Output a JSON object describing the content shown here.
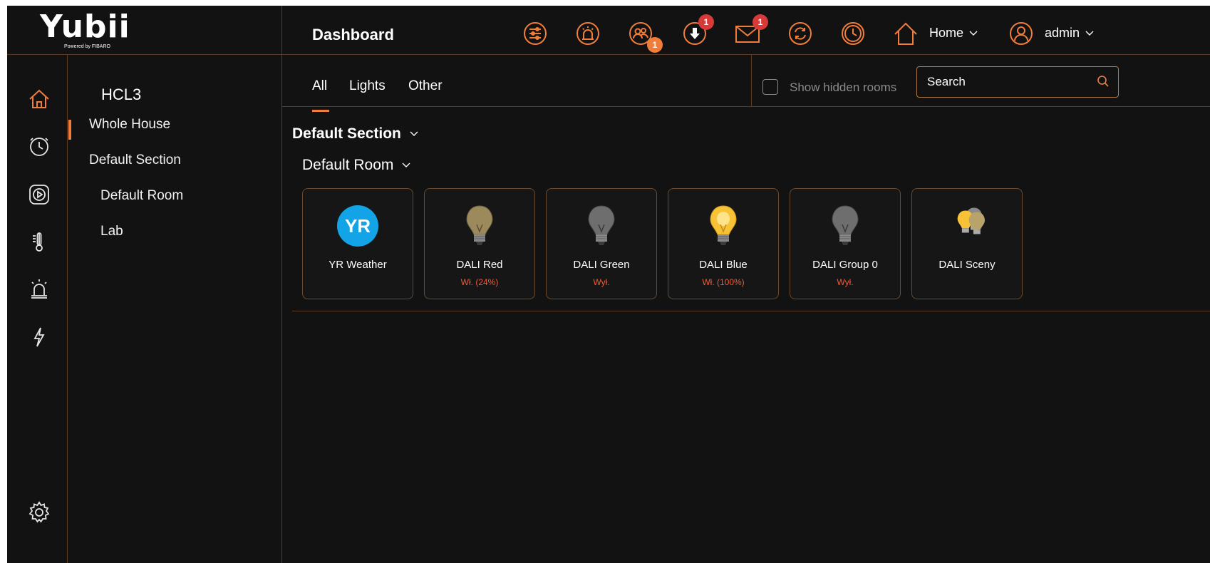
{
  "logo": {
    "word": "Yubii",
    "sub": "Powered by FIBARO"
  },
  "header": {
    "title": "Dashboard",
    "badges": {
      "users": "1",
      "download": "1",
      "mail": "1"
    },
    "home_label": "Home",
    "user_label": "admin"
  },
  "rooms": {
    "title": "HCL3",
    "items": [
      {
        "label": "Whole House"
      },
      {
        "label": "Default Section"
      },
      {
        "label": "Default Room"
      },
      {
        "label": "Lab"
      }
    ]
  },
  "tabs": {
    "all": "All",
    "lights": "Lights",
    "other": "Other"
  },
  "filters": {
    "show_hidden_label": "Show hidden rooms",
    "search_placeholder": "Search"
  },
  "section": {
    "title": "Default Section",
    "room": "Default Room"
  },
  "devices": [
    {
      "name": "YR Weather",
      "status": "",
      "icon": "yr-weather-icon"
    },
    {
      "name": "DALI Red",
      "status": "Wł. (24%)",
      "icon": "bulb-dim-icon"
    },
    {
      "name": "DALI Green",
      "status": "Wył.",
      "icon": "bulb-off-icon"
    },
    {
      "name": "DALI Blue",
      "status": "Wł. (100%)",
      "icon": "bulb-on-icon"
    },
    {
      "name": "DALI Group 0",
      "status": "Wył.",
      "icon": "bulb-off-icon"
    },
    {
      "name": "DALI Sceny",
      "status": "",
      "icon": "bulbs-scene-icon"
    }
  ],
  "colors": {
    "accent": "#f07d3a",
    "badge_red": "#d83a3a",
    "status_red": "#f05a3a",
    "border_brown": "#5a3a22"
  }
}
